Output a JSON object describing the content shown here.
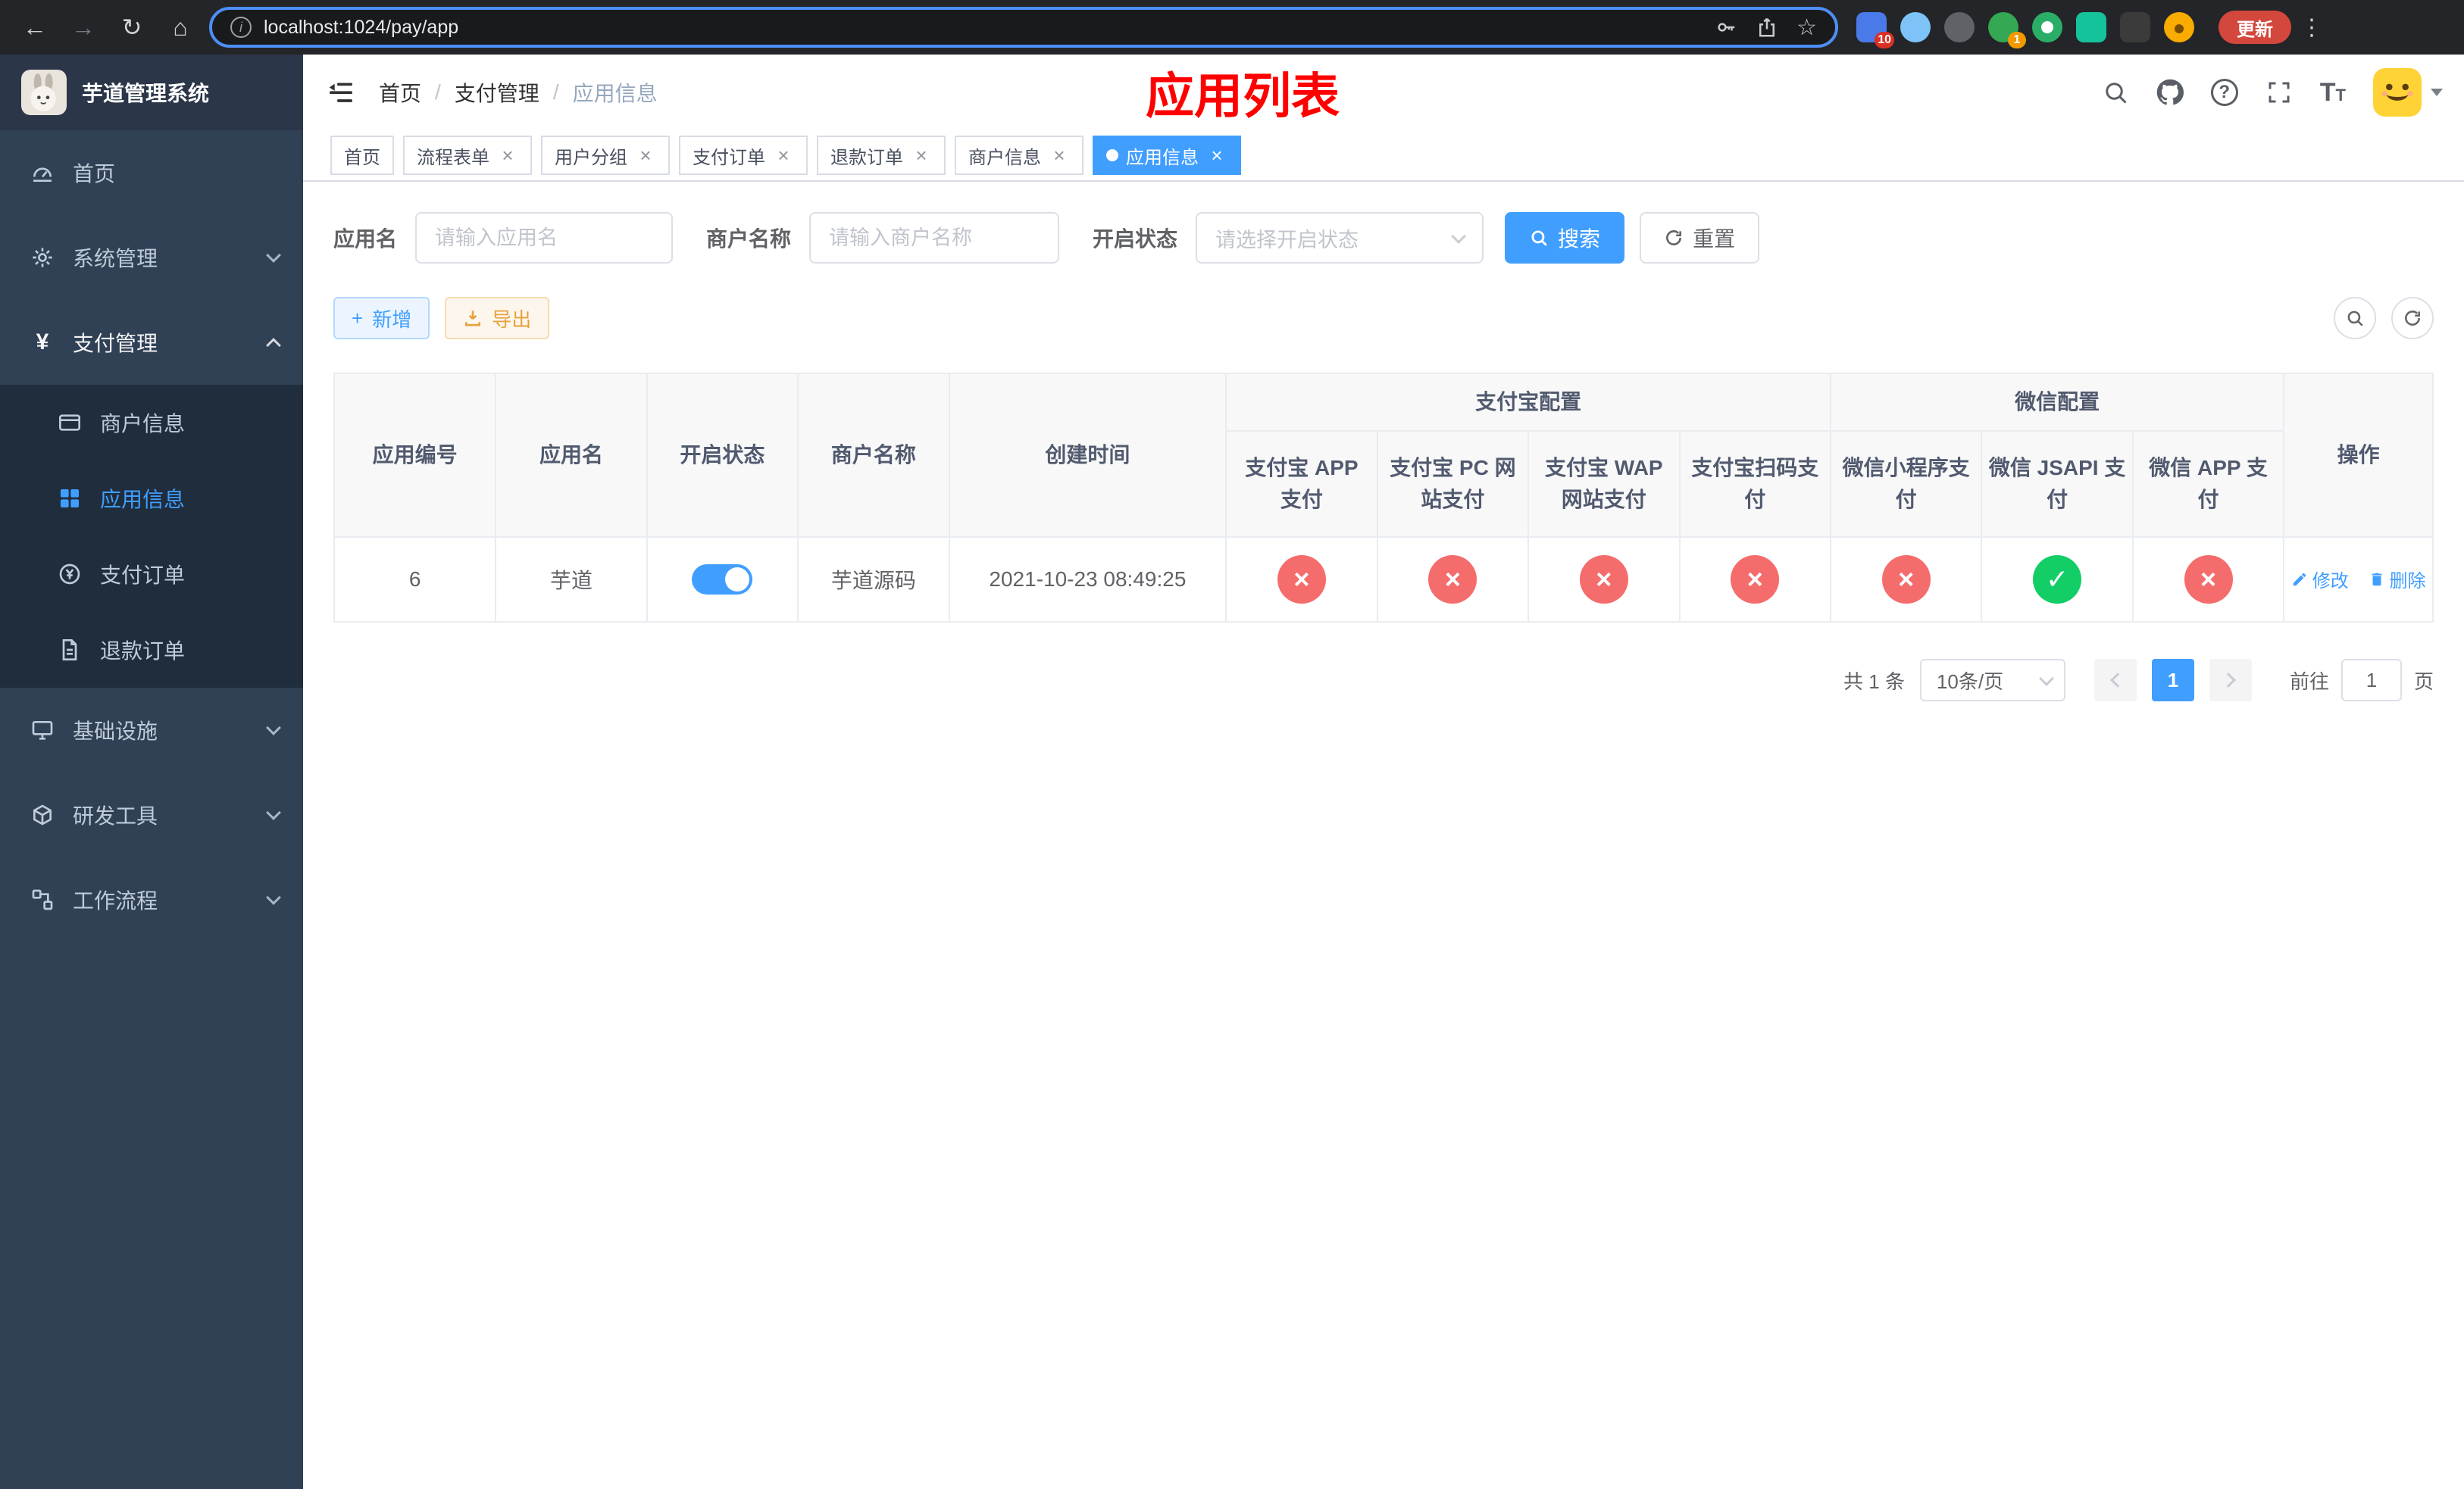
{
  "colors": {
    "accent": "#409eff",
    "danger": "#f56c6c",
    "success": "#13ce66",
    "warning": "#e6a23c",
    "title_red": "#ff0000",
    "sidebar_bg": "#304156"
  },
  "browser": {
    "url": "localhost:1024/pay/app",
    "update_label": "更新",
    "ext_badge_blue": "10",
    "ext_badge_green": "1"
  },
  "sidebar": {
    "title": "芋道管理系统",
    "menu": [
      {
        "label": "首页"
      },
      {
        "label": "系统管理"
      },
      {
        "label": "支付管理"
      },
      {
        "label": "基础设施"
      },
      {
        "label": "研发工具"
      },
      {
        "label": "工作流程"
      }
    ],
    "submenu_pay": [
      {
        "label": "商户信息"
      },
      {
        "label": "应用信息"
      },
      {
        "label": "支付订单"
      },
      {
        "label": "退款订单"
      }
    ]
  },
  "navbar": {
    "breadcrumb": [
      "首页",
      "支付管理",
      "应用信息"
    ],
    "overlay_title": "应用列表"
  },
  "tabs": [
    {
      "label": "首页"
    },
    {
      "label": "流程表单"
    },
    {
      "label": "用户分组"
    },
    {
      "label": "支付订单"
    },
    {
      "label": "退款订单"
    },
    {
      "label": "商户信息"
    },
    {
      "label": "应用信息"
    }
  ],
  "search": {
    "app_name_label": "应用名",
    "app_name_placeholder": "请输入应用名",
    "merchant_label": "商户名称",
    "merchant_placeholder": "请输入商户名称",
    "status_label": "开启状态",
    "status_placeholder": "请选择开启状态",
    "search_label": "搜索",
    "reset_label": "重置"
  },
  "toolbar": {
    "add_label": "新增",
    "export_label": "导出"
  },
  "table": {
    "headers": {
      "app_id": "应用编号",
      "app_name": "应用名",
      "status": "开启状态",
      "merchant": "商户名称",
      "created": "创建时间",
      "alipay_group": "支付宝配置",
      "wechat_group": "微信配置",
      "alipay_app": "支付宝 APP 支付",
      "alipay_pc": "支付宝 PC 网站支付",
      "alipay_wap": "支付宝 WAP 网站支付",
      "alipay_qr": "支付宝扫码支付",
      "wx_mini": "微信小程序支付",
      "wx_jsapi": "微信 JSAPI 支付",
      "wx_app": "微信 APP 支付",
      "actions": "操作"
    },
    "symbols": {
      "success": "✓",
      "fail": "×"
    },
    "rows": [
      {
        "app_id": "6",
        "app_name": "芋道",
        "status_on": true,
        "merchant": "芋道源码",
        "created": "2021-10-23 08:49:25",
        "configs": [
          "fail",
          "fail",
          "fail",
          "fail",
          "fail",
          "success",
          "fail"
        ],
        "edit_label": "修改",
        "delete_label": "删除"
      }
    ]
  },
  "pagination": {
    "total": "共 1 条",
    "page_size": "10条/页",
    "page": "1",
    "goto_prefix": "前往",
    "goto_value": "1",
    "goto_suffix": "页"
  }
}
